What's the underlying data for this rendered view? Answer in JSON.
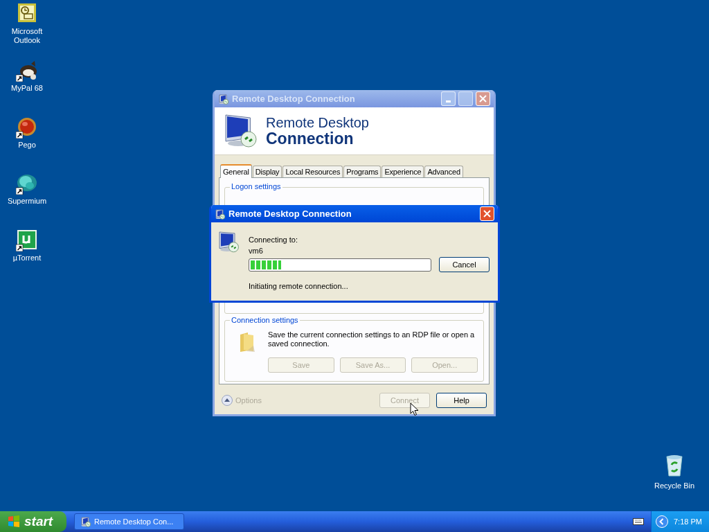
{
  "desktop_icons": [
    {
      "label": "Microsoft Outlook",
      "kind": "outlook",
      "shortcut": false
    },
    {
      "label": "MyPal 68",
      "kind": "mypal",
      "shortcut": true
    },
    {
      "label": "Pego",
      "kind": "pego",
      "shortcut": true
    },
    {
      "label": "Supermium",
      "kind": "supermium",
      "shortcut": true
    },
    {
      "label": "µTorrent",
      "kind": "utorrent",
      "shortcut": true
    }
  ],
  "recycle_bin": {
    "label": "Recycle Bin"
  },
  "main_window": {
    "title": "Remote Desktop Connection",
    "active": false,
    "header_line1": "Remote Desktop",
    "header_line2": "Connection",
    "tabs": [
      {
        "label": "General",
        "selected": true
      },
      {
        "label": "Display",
        "selected": false
      },
      {
        "label": "Local Resources",
        "selected": false
      },
      {
        "label": "Programs",
        "selected": false
      },
      {
        "label": "Experience",
        "selected": false
      },
      {
        "label": "Advanced",
        "selected": false
      }
    ],
    "logon_group": {
      "title": "Logon settings"
    },
    "connection_group": {
      "title": "Connection settings",
      "description": "Save the current connection settings to an RDP file or open a saved connection.",
      "buttons": [
        {
          "label": "Save",
          "disabled": true
        },
        {
          "label": "Save As...",
          "disabled": true
        },
        {
          "label": "Open...",
          "disabled": true
        }
      ]
    },
    "options": {
      "label": "Options"
    },
    "buttons": [
      {
        "label": "Connect",
        "disabled": true
      },
      {
        "label": "Help",
        "disabled": false
      }
    ]
  },
  "dialog": {
    "title": "Remote Desktop Connection",
    "active": true,
    "label": "Connecting to:",
    "host": "vm6",
    "progress": {
      "level": 0.17
    },
    "status": "Initiating remote connection...",
    "button": "Cancel"
  },
  "taskbar": {
    "start": "start",
    "tasks": [
      {
        "label": "Remote Desktop Con...",
        "selected": false
      }
    ],
    "clock": "7:18 PM"
  }
}
